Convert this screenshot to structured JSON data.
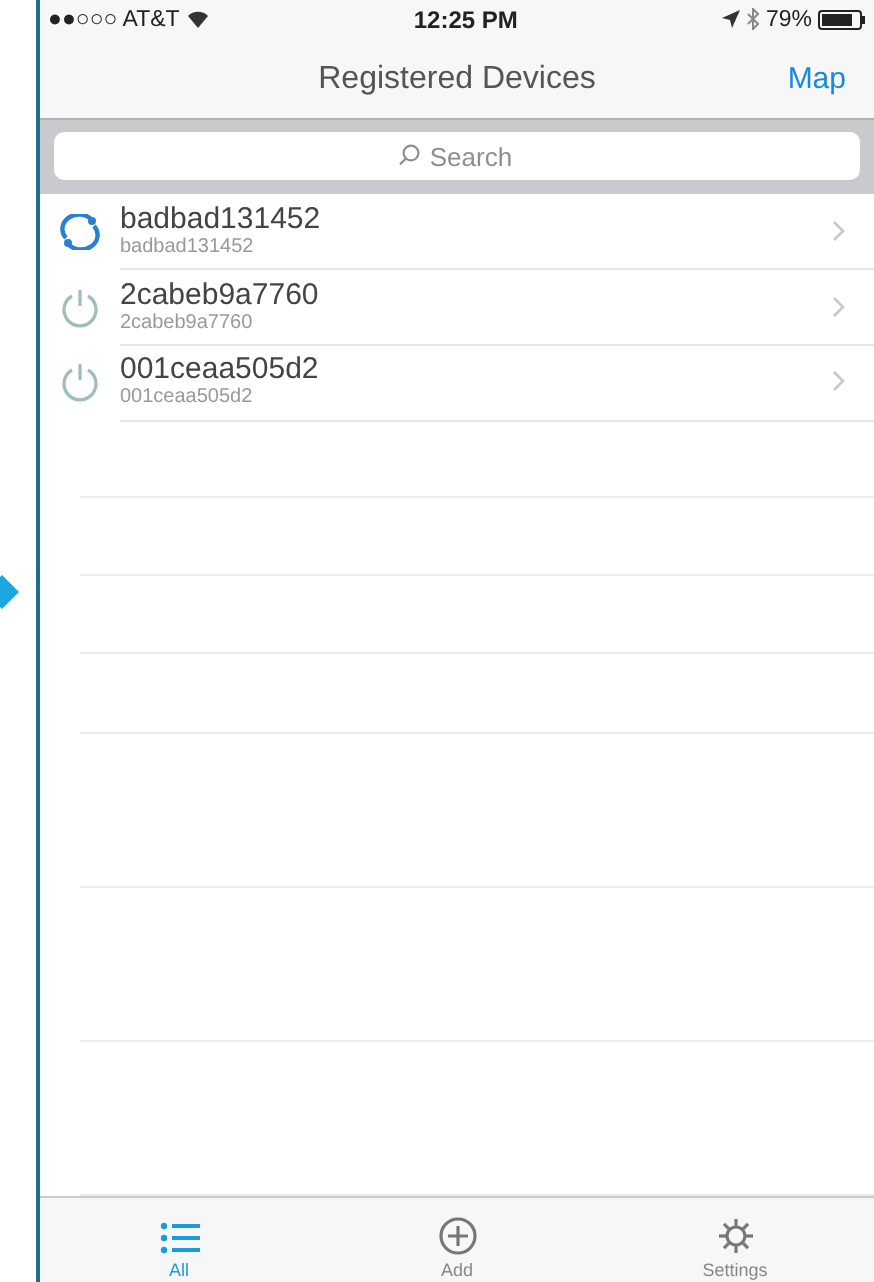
{
  "status_bar": {
    "carrier": "●●○○○ AT&T",
    "time": "12:25 PM",
    "battery": "79%"
  },
  "nav": {
    "title": "Registered Devices",
    "action": "Map"
  },
  "search": {
    "placeholder": "Search"
  },
  "devices": [
    {
      "name": "badbad131452",
      "subtitle": "badbad131452",
      "kind": "syncing"
    },
    {
      "name": "2cabeb9a7760",
      "subtitle": "2cabeb9a7760",
      "kind": "off"
    },
    {
      "name": "001ceaa505d2",
      "subtitle": "001ceaa505d2",
      "kind": "off"
    }
  ],
  "tabs": [
    {
      "label": "All",
      "kind": "list",
      "selected": true
    },
    {
      "label": "Add",
      "kind": "add",
      "selected": false
    },
    {
      "label": "Settings",
      "kind": "settings",
      "selected": false
    }
  ]
}
